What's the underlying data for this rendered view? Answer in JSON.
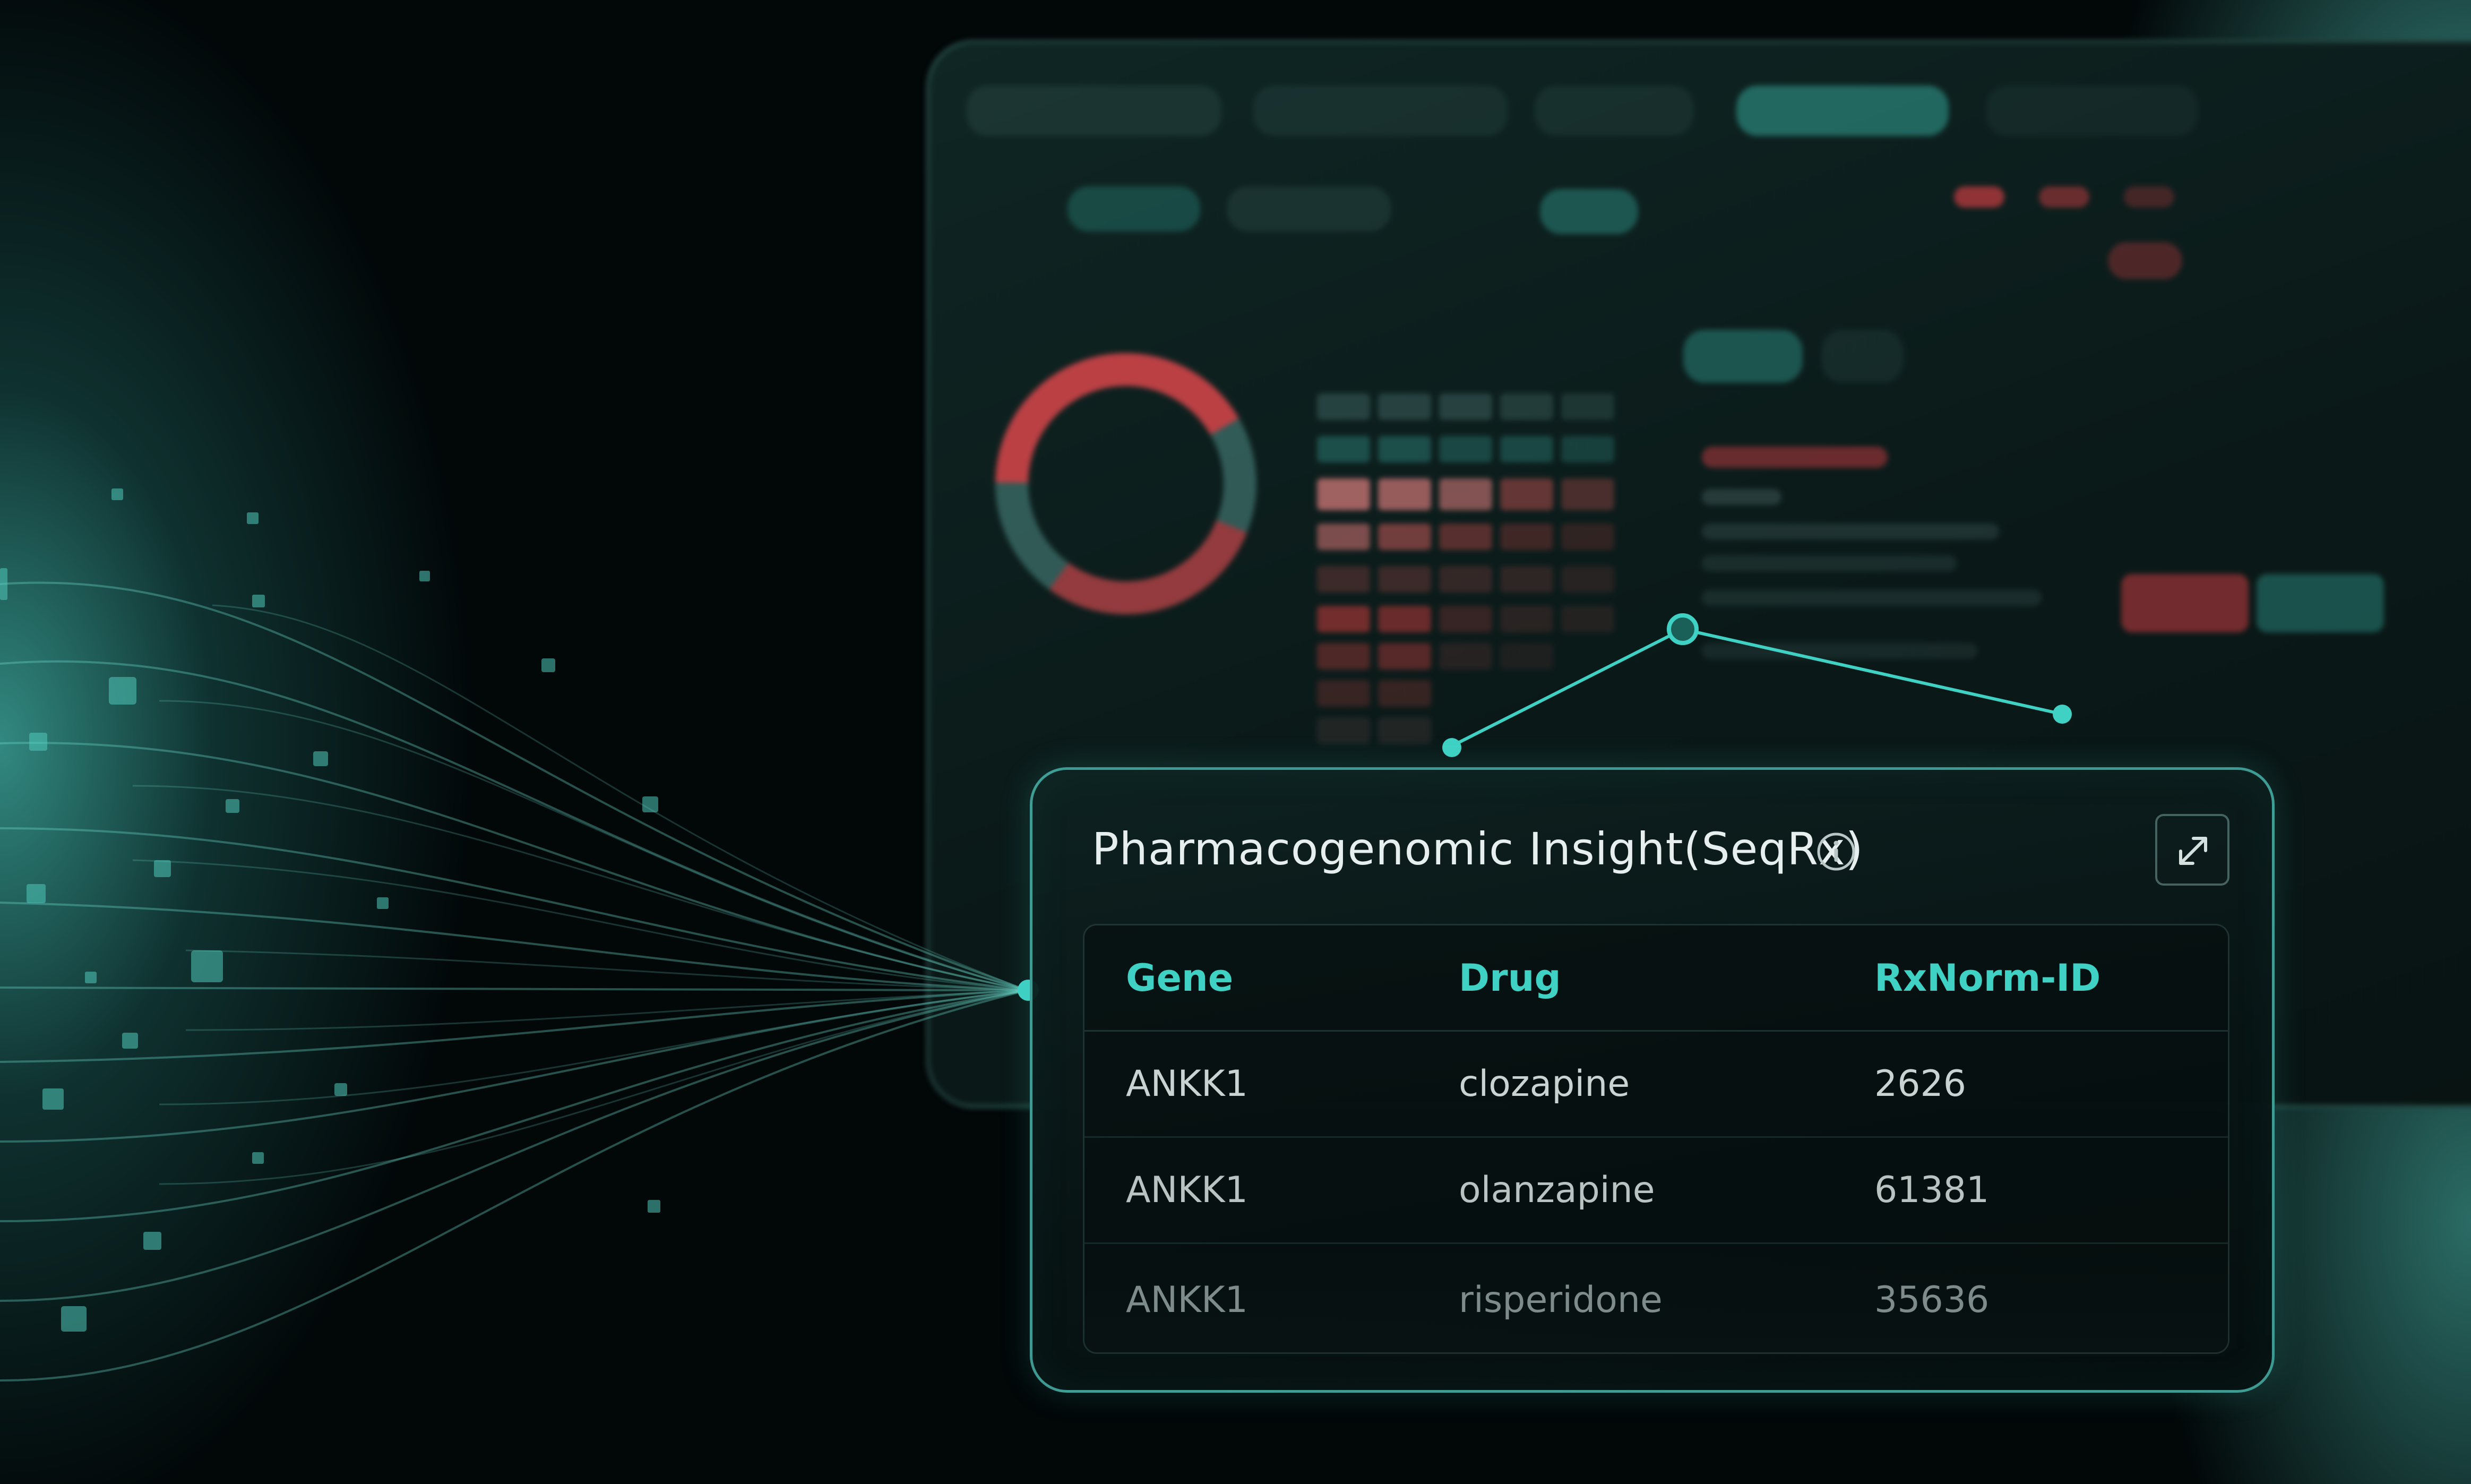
{
  "card": {
    "title": "Pharmacogenomic Insight(SeqRx)",
    "info_icon": "info-icon",
    "expand_icon": "expand-icon"
  },
  "table": {
    "headers": [
      "Gene",
      "Drug",
      "RxNorm-ID"
    ],
    "rows": [
      {
        "gene": "ANKK1",
        "drug": "clozapine",
        "rxnorm_id": "2626"
      },
      {
        "gene": "ANKK1",
        "drug": "olanzapine",
        "rxnorm_id": "61381"
      },
      {
        "gene": "ANKK1",
        "drug": "risperidone",
        "rxnorm_id": "35636"
      }
    ]
  },
  "colors": {
    "accent": "#3fd2c4",
    "alert_red": "#c0393e",
    "background": "#020708"
  }
}
